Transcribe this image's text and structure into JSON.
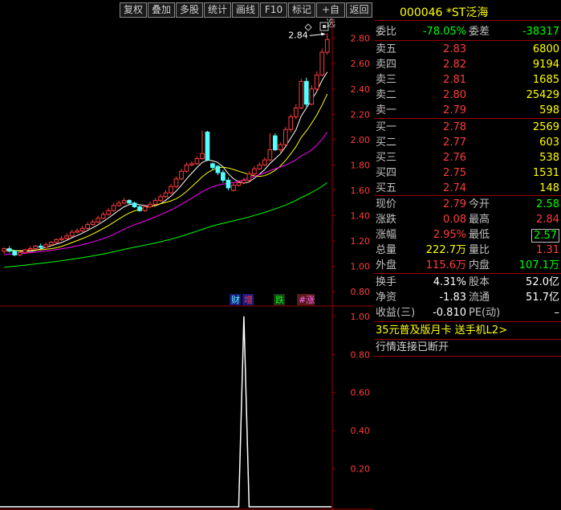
{
  "toolbar": {
    "buttons": [
      "复权",
      "叠加",
      "多股",
      "统计",
      "画线",
      "F10",
      "标记",
      "+自选",
      "返回"
    ]
  },
  "stock": {
    "code": "000046",
    "name": "*ST泛海"
  },
  "colors": {
    "up": "#ff3c3c",
    "down": "#00ff00",
    "neutral": "#c0c0c0",
    "candle_down": "#54ffff",
    "ma5": "#ffffff",
    "ma10": "#ffff00",
    "ma20": "#ff00ff",
    "ma60": "#00ff00",
    "border": "#990000",
    "bg": "#000000",
    "header": "#ffff00"
  },
  "chart_data": [
    {
      "type": "candlestick",
      "title": "",
      "xlabel": "",
      "ylabel": "",
      "ylim": [
        0.7,
        2.95
      ],
      "yticks": [
        "2.80",
        "2.60",
        "2.40",
        "2.20",
        "2.00",
        "1.80",
        "1.60",
        "1.40",
        "1.20",
        "1.00",
        "0.80"
      ],
      "annotation": "2.84",
      "series": [
        {
          "open": [
            1.12,
            1.14,
            1.12,
            1.09,
            1.11,
            1.13,
            1.14,
            1.16,
            1.15,
            1.17,
            1.19,
            1.21,
            1.22,
            1.24,
            1.27,
            1.28,
            1.3,
            1.33,
            1.35,
            1.38,
            1.41,
            1.44,
            1.48,
            1.5,
            1.52,
            1.5,
            1.47,
            1.44,
            1.47,
            1.49,
            1.52,
            1.55,
            1.58,
            1.63,
            1.69,
            1.75,
            1.8,
            1.81,
            1.85,
            2.06,
            1.81,
            1.79,
            1.74,
            1.68,
            1.6,
            1.64,
            1.66,
            1.68,
            1.73,
            1.77,
            1.8,
            1.84,
            2.03,
            1.92,
            1.96,
            2.08,
            2.18,
            2.25,
            2.46,
            2.28,
            2.4,
            2.51,
            2.69
          ],
          "close": [
            1.14,
            1.12,
            1.09,
            1.11,
            1.13,
            1.14,
            1.16,
            1.15,
            1.17,
            1.19,
            1.21,
            1.22,
            1.24,
            1.27,
            1.28,
            1.3,
            1.33,
            1.35,
            1.38,
            1.41,
            1.44,
            1.48,
            1.5,
            1.52,
            1.5,
            1.47,
            1.44,
            1.47,
            1.49,
            1.52,
            1.55,
            1.58,
            1.63,
            1.69,
            1.75,
            1.8,
            1.81,
            1.85,
            1.89,
            1.84,
            1.78,
            1.74,
            1.68,
            1.62,
            1.64,
            1.66,
            1.68,
            1.73,
            1.77,
            1.8,
            1.84,
            1.92,
            1.92,
            1.96,
            2.08,
            2.18,
            2.25,
            2.46,
            2.28,
            2.4,
            2.51,
            2.69,
            2.79
          ],
          "high": [
            1.15,
            1.16,
            1.13,
            1.12,
            1.14,
            1.16,
            1.17,
            1.18,
            1.19,
            1.2,
            1.22,
            1.24,
            1.26,
            1.29,
            1.3,
            1.32,
            1.35,
            1.37,
            1.4,
            1.43,
            1.46,
            1.5,
            1.52,
            1.54,
            1.53,
            1.51,
            1.48,
            1.48,
            1.51,
            1.54,
            1.57,
            1.6,
            1.65,
            1.71,
            1.77,
            1.82,
            1.83,
            1.87,
            2.07,
            2.07,
            1.82,
            1.8,
            1.76,
            1.7,
            1.66,
            1.68,
            1.7,
            1.75,
            1.79,
            1.82,
            1.86,
            2.05,
            2.05,
            1.98,
            2.1,
            2.2,
            2.28,
            2.48,
            2.49,
            2.43,
            2.54,
            2.72,
            2.84
          ],
          "low": [
            1.1,
            1.11,
            1.08,
            1.08,
            1.1,
            1.12,
            1.13,
            1.14,
            1.14,
            1.16,
            1.18,
            1.2,
            1.21,
            1.23,
            1.26,
            1.27,
            1.29,
            1.32,
            1.34,
            1.37,
            1.4,
            1.43,
            1.47,
            1.49,
            1.49,
            1.46,
            1.43,
            1.43,
            1.46,
            1.48,
            1.51,
            1.54,
            1.57,
            1.62,
            1.68,
            1.74,
            1.79,
            1.8,
            1.84,
            1.83,
            1.76,
            1.72,
            1.66,
            1.6,
            1.59,
            1.63,
            1.65,
            1.67,
            1.72,
            1.76,
            1.79,
            1.83,
            1.91,
            1.9,
            1.95,
            2.06,
            2.16,
            2.24,
            2.26,
            2.27,
            2.38,
            2.5,
            2.67
          ]
        }
      ],
      "markers": [
        "财",
        "增",
        "跌",
        "#涨"
      ]
    },
    {
      "type": "line",
      "title": "",
      "ylim": [
        0.0,
        1.05
      ],
      "yticks": [
        "1.00",
        "0.80",
        "0.60",
        "0.40",
        "0.20"
      ],
      "values": [
        0,
        0,
        0,
        0,
        0,
        0,
        0,
        0,
        0,
        0,
        0,
        0,
        0,
        0,
        0,
        0,
        0,
        0,
        0,
        0,
        0,
        0,
        0,
        0,
        0,
        0,
        0,
        0,
        0,
        0,
        0,
        0,
        0,
        0,
        0,
        0,
        0,
        0,
        0,
        0,
        0,
        0,
        0,
        0,
        0,
        0,
        1,
        0,
        0,
        0,
        0,
        0,
        0,
        0,
        0,
        0,
        0,
        0,
        0,
        0,
        0,
        0,
        0
      ]
    }
  ],
  "panel": {
    "weibi": {
      "label": "委比",
      "value": "-78.05%",
      "label2": "委差",
      "value2": "-38317"
    },
    "asks": [
      {
        "label": "卖五",
        "price": "2.83",
        "vol": "6800"
      },
      {
        "label": "卖四",
        "price": "2.82",
        "vol": "9194"
      },
      {
        "label": "卖三",
        "price": "2.81",
        "vol": "1685"
      },
      {
        "label": "卖二",
        "price": "2.80",
        "vol": "25429"
      },
      {
        "label": "卖一",
        "price": "2.79",
        "vol": "598"
      }
    ],
    "bids": [
      {
        "label": "买一",
        "price": "2.78",
        "vol": "2569"
      },
      {
        "label": "买二",
        "price": "2.77",
        "vol": "603"
      },
      {
        "label": "买三",
        "price": "2.76",
        "vol": "538"
      },
      {
        "label": "买四",
        "price": "2.75",
        "vol": "1531"
      },
      {
        "label": "买五",
        "price": "2.74",
        "vol": "148"
      }
    ],
    "quote": [
      {
        "l1": "现价",
        "v1": "2.79",
        "l2": "今开",
        "v2": "2.58"
      },
      {
        "l1": "涨跌",
        "v1": "0.08",
        "l2": "最高",
        "v2": "2.84"
      },
      {
        "l1": "涨幅",
        "v1": "2.95%",
        "l2": "最低",
        "v2": "2.57"
      },
      {
        "l1": "总量",
        "v1": "222.7万",
        "l2": "量比",
        "v2": "1.31"
      },
      {
        "l1": "外盘",
        "v1": "115.6万",
        "l2": "内盘",
        "v2": "107.1万"
      }
    ],
    "fin": [
      {
        "l1": "换手",
        "v1": "4.31%",
        "l2": "股本",
        "v2": "52.0亿"
      },
      {
        "l1": "净资",
        "v1": "-1.83",
        "l2": "流通",
        "v2": "51.7亿"
      },
      {
        "l1": "收益(三)",
        "v1": "-0.810",
        "l2": "PE(动)",
        "v2": "–"
      }
    ],
    "promo": "35元普及版月卡 送手机L2>",
    "status": "行情连接已断开"
  }
}
